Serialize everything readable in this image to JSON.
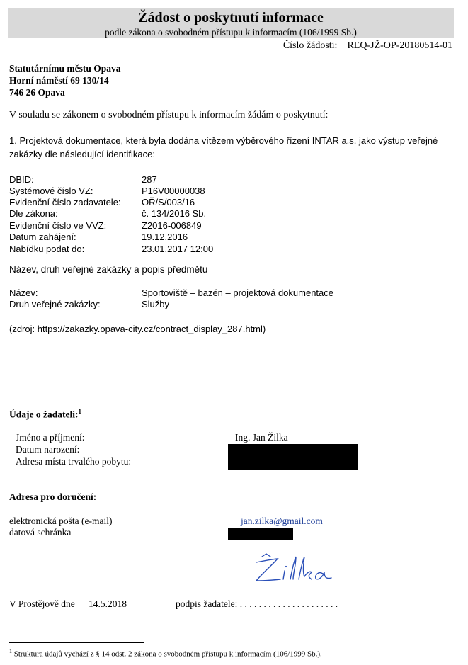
{
  "header": {
    "title": "Žádost o poskytnutí informace",
    "subtitle": "podle zákona o svobodném přístupu k informacím (106/1999 Sb.)",
    "request_label": "Číslo žádosti:",
    "request_number": "REQ-JŽ-OP-20180514-01"
  },
  "recipient": {
    "line1": "Statutárnímu městu Opava",
    "line2": "Horní náměstí 69 130/14",
    "line3": "746 26 Opava"
  },
  "intro": "V souladu se zákonem o svobodném přístupu k informacím žádám o poskytnutí:",
  "item1": "1. Projektová dokumentace, která byla dodána vítězem výběrového řízení INTAR a.s. jako výstup veřejné zakázky dle následující identifikace:",
  "identification": [
    {
      "label": "DBID:",
      "value": "287"
    },
    {
      "label": "Systémové číslo VZ:",
      "value": "P16V00000038"
    },
    {
      "label": "Evidenční číslo zadavatele:",
      "value": "OŘ/S/003/16"
    },
    {
      "label": "Dle zákona:",
      "value": "č. 134/2016 Sb."
    },
    {
      "label": "Evidenční číslo ve VVZ:",
      "value": "Z2016-006849"
    },
    {
      "label": "Datum zahájení:",
      "value": "19.12.2016"
    },
    {
      "label": "Nabídku podat do:",
      "value": "23.01.2017 12:00"
    }
  ],
  "section2_heading": "Název, druh veřejné zakázky a popis předmětu",
  "section2": [
    {
      "label": "Název:",
      "value": "Sportoviště – bazén – projektová dokumentace"
    },
    {
      "label": "Druh veřejné zakázky:",
      "value": "Služby"
    }
  ],
  "source": "(zdroj: https://zakazky.opava-city.cz/contract_display_287.html)",
  "applicant": {
    "heading": "Údaje o žadateli:",
    "footnote_mark": "1",
    "name_label": "Jméno a příjmení:",
    "name_value": "Ing. Jan Žilka",
    "birth_label": "Datum narození:",
    "address_label": "Adresa místa trvalého pobytu:"
  },
  "delivery": {
    "heading": "Adresa pro doručení:",
    "email_label": "elektronická pošta (e-mail)",
    "email_value": "jan.zilka@gmail.com",
    "databox_label": "datová schránka"
  },
  "signature_text": "Žilka",
  "place_date": {
    "place": "V Prostějově dne",
    "date": "14.5.2018",
    "signature_label": "podpis žadatele: . . . . . . . . . . . . . . . . . . . . ."
  },
  "footnote": {
    "mark": "1",
    "text": "Struktura údajů vychází z § 14 odst. 2 zákona o svobodném přístupu k informacím (106/1999 Sb.)."
  }
}
